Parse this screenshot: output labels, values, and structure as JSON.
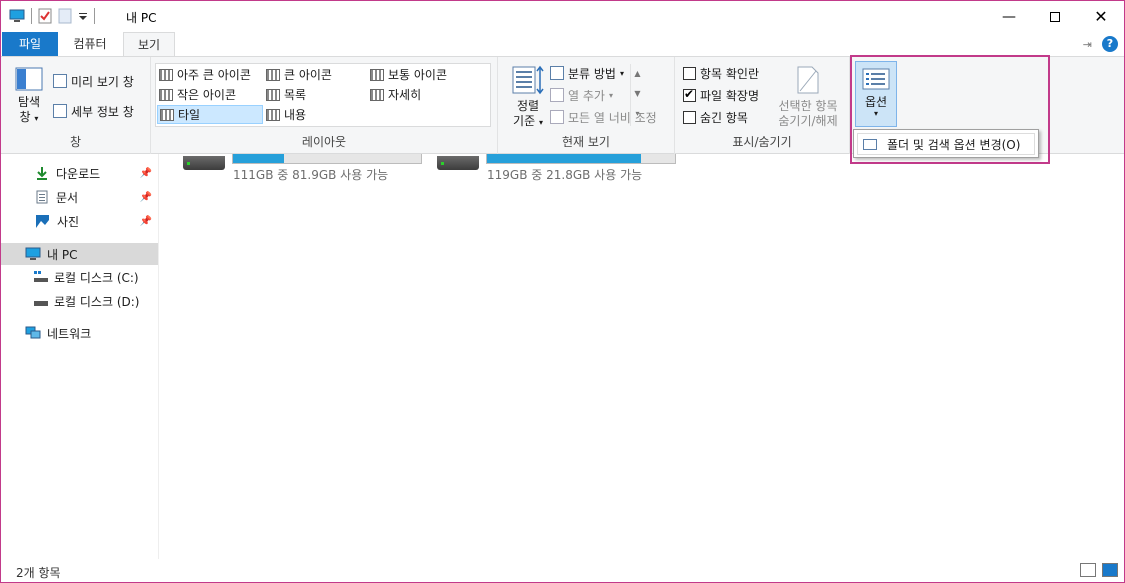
{
  "window": {
    "title": "내 PC",
    "accent": "#1979ca",
    "highlight": "#c23a8a"
  },
  "qat": {
    "icons": [
      "pc-icon",
      "properties-icon",
      "new-folder-icon",
      "customize-arrow-icon"
    ]
  },
  "tabs": [
    {
      "label": "파일"
    },
    {
      "label": "컴퓨터"
    },
    {
      "label": "보기"
    }
  ],
  "ribbon": {
    "pane": {
      "nav_pane_label_1": "탐색",
      "nav_pane_label_2": "창",
      "preview_pane": "미리 보기 창",
      "details_pane": "세부 정보 창",
      "group_label": "창"
    },
    "layout": {
      "items": [
        "아주 큰 아이콘",
        "큰 아이콘",
        "보통 아이콘",
        "작은 아이콘",
        "목록",
        "자세히",
        "타일",
        "내용"
      ],
      "group_label": "레이아웃"
    },
    "current_view": {
      "sort_label_1": "정렬",
      "sort_label_2": "기준",
      "group_by": "분류 방법",
      "add_columns": "열 추가",
      "size_columns": "모든 열 너비 조정",
      "group_label": "현재 보기"
    },
    "show_hide": {
      "item_checkboxes": "항목 확인란",
      "file_extensions": "파일 확장명",
      "hidden_items": "숨긴 항목",
      "hide_selected_1": "선택한 항목",
      "hide_selected_2": "숨기기/해제",
      "group_label": "표시/숨기기",
      "checks": {
        "item_checkboxes": false,
        "file_extensions": true,
        "hidden_items": false
      }
    },
    "options": {
      "label": "옵션",
      "menu_item": "폴더 및 검색 옵션 변경(O)"
    }
  },
  "nav": {
    "items": [
      {
        "label": "다운로드",
        "pinned": true
      },
      {
        "label": "문서",
        "pinned": true
      },
      {
        "label": "사진",
        "pinned": true
      },
      {
        "label": "내 PC"
      },
      {
        "label": "로컬 디스크 (C:)"
      },
      {
        "label": "로컬 디스크 (D:)"
      },
      {
        "label": "네트워크"
      }
    ]
  },
  "drives": [
    {
      "free_text": "111GB 중 81.9GB 사용 가능",
      "used_fraction": 0.27
    },
    {
      "free_text": "119GB 중 21.8GB 사용 가능",
      "used_fraction": 0.82
    }
  ],
  "status": {
    "item_count": "2개 항목"
  }
}
